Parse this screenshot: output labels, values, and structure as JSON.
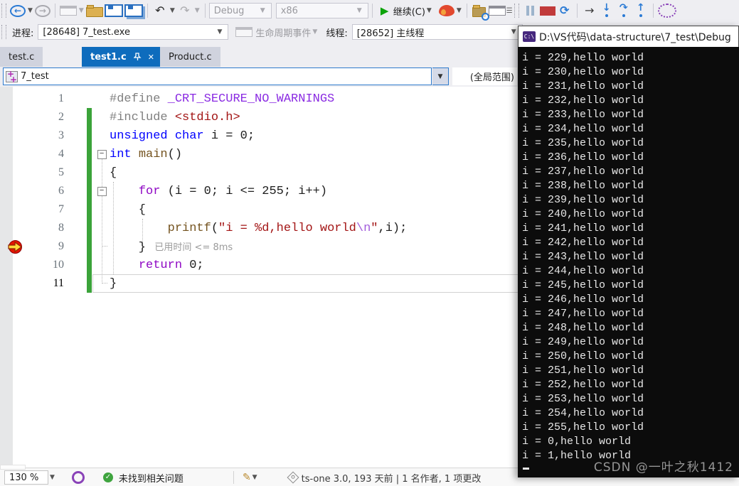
{
  "toolbar": {
    "debug_config": "Debug",
    "platform": "x86",
    "continue_label": "继续(C)"
  },
  "toolbar2": {
    "process_label": "进程:",
    "process_value": "[28648] 7_test.exe",
    "lifecycle_label": "生命周期事件",
    "thread_label": "线程:",
    "thread_value": "[28652] 主线程"
  },
  "tabs": [
    {
      "label": "test.c",
      "active": false
    },
    {
      "label": "test1.c",
      "active": true
    },
    {
      "label": "Product.c",
      "active": false
    }
  ],
  "navbar": {
    "scope": "7_test",
    "member": "(全局范围)"
  },
  "editor": {
    "current_line": 11,
    "breakpoint_line": 9,
    "lines": [
      {
        "num": 1,
        "spans": [
          [
            "g",
            "#define "
          ],
          [
            "m",
            "_CRT_SECURE_NO_WARNINGS"
          ]
        ]
      },
      {
        "num": 2,
        "chg": true,
        "spans": [
          [
            "g",
            "#include "
          ],
          [
            "s",
            "<stdio.h>"
          ]
        ]
      },
      {
        "num": 3,
        "chg": true,
        "spans": [
          [
            "k",
            "unsigned"
          ],
          [
            "p",
            " "
          ],
          [
            "k",
            "char"
          ],
          [
            "p",
            " i = 0;"
          ]
        ]
      },
      {
        "num": 4,
        "chg": true,
        "fold": true,
        "spans": [
          [
            "k",
            "int"
          ],
          [
            "p",
            " "
          ],
          [
            "f",
            "main"
          ],
          [
            "p",
            "()"
          ]
        ]
      },
      {
        "num": 5,
        "chg": true,
        "spans": [
          [
            "p",
            "{"
          ]
        ]
      },
      {
        "num": 6,
        "chg": true,
        "fold": true,
        "spans": [
          [
            "p",
            "    "
          ],
          [
            "c",
            "for"
          ],
          [
            "p",
            " (i = 0; i <= 255; i++)"
          ]
        ]
      },
      {
        "num": 7,
        "chg": true,
        "spans": [
          [
            "p",
            "    {"
          ]
        ]
      },
      {
        "num": 8,
        "chg": true,
        "spans": [
          [
            "p",
            "        "
          ],
          [
            "f",
            "printf"
          ],
          [
            "p",
            "("
          ],
          [
            "s",
            "\"i = %d,hello world"
          ],
          [
            "e",
            "\\n"
          ],
          [
            "s",
            "\""
          ],
          [
            "p",
            ",i);"
          ]
        ]
      },
      {
        "num": 9,
        "chg": true,
        "spans": [
          [
            "p",
            "    }"
          ],
          [
            "t",
            "   已用时间 <= 8ms"
          ]
        ]
      },
      {
        "num": 10,
        "chg": true,
        "spans": [
          [
            "p",
            "    "
          ],
          [
            "c",
            "return"
          ],
          [
            "p",
            " 0;"
          ]
        ]
      },
      {
        "num": 11,
        "chg": true,
        "spans": [
          [
            "p",
            "}"
          ]
        ]
      }
    ]
  },
  "console": {
    "title": "D:\\VS代码\\data-structure\\7_test\\Debug",
    "lines": [
      "i = 229,hello world",
      "i = 230,hello world",
      "i = 231,hello world",
      "i = 232,hello world",
      "i = 233,hello world",
      "i = 234,hello world",
      "i = 235,hello world",
      "i = 236,hello world",
      "i = 237,hello world",
      "i = 238,hello world",
      "i = 239,hello world",
      "i = 240,hello world",
      "i = 241,hello world",
      "i = 242,hello world",
      "i = 243,hello world",
      "i = 244,hello world",
      "i = 245,hello world",
      "i = 246,hello world",
      "i = 247,hello world",
      "i = 248,hello world",
      "i = 249,hello world",
      "i = 250,hello world",
      "i = 251,hello world",
      "i = 252,hello world",
      "i = 253,hello world",
      "i = 254,hello world",
      "i = 255,hello world",
      "i = 0,hello world",
      "i = 1,hello world"
    ],
    "watermark": "CSDN @一叶之秋1412"
  },
  "statusbar": {
    "zoom": "130 %",
    "health": "未找到相关问题",
    "git": "ts-one 3.0, 193 天前 | 1 名作者, 1 项更改"
  }
}
